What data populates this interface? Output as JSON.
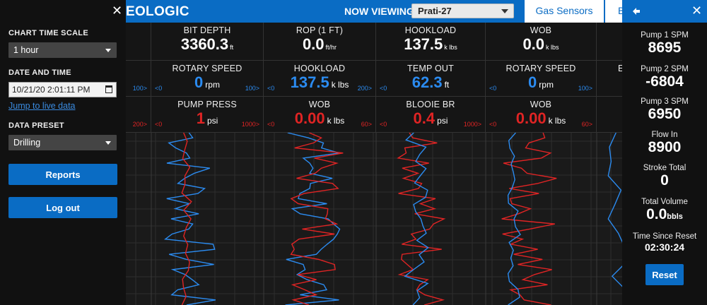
{
  "topbar": {
    "brand": "EOLOGIC",
    "now_viewing_label": "NOW VIEWING",
    "well": "Prati-27",
    "tab_active": "Gas Sensors",
    "tab_next": "B",
    "colors": {
      "bar": "#0a6cc4"
    }
  },
  "metrics": {
    "row1": [
      {
        "label": "BIT DEPTH",
        "value": "3360.3",
        "unit": "ft"
      },
      {
        "label": "ROP (1 FT)",
        "value": "0.0",
        "unit": "ft/hr"
      },
      {
        "label": "HOOKLOAD",
        "value": "137.5",
        "unit": "k lbs"
      },
      {
        "label": "WOB",
        "value": "0.0",
        "unit": "k lbs"
      }
    ],
    "row2": [
      {
        "label": "",
        "min": "",
        "max": "100>"
      },
      {
        "label": "ROTARY SPEED",
        "value": "0",
        "unit": "rpm",
        "min": "<0",
        "max": "100>"
      },
      {
        "label": "HOOKLOAD",
        "value": "137.5",
        "unit": "k lbs",
        "min": "<0",
        "max": "200>"
      },
      {
        "label": "TEMP OUT",
        "value": "62.3",
        "unit": "ft",
        "min": "<0",
        "max": ""
      },
      {
        "label": "ROTARY SPEED",
        "value": "0",
        "unit": "rpm",
        "min": "<0",
        "max": "100>"
      },
      {
        "label": "E"
      }
    ],
    "row3": [
      {
        "label": "",
        "max": "200>"
      },
      {
        "label": "PUMP PRESS",
        "value": "1",
        "unit": "psi",
        "min": "<0",
        "max": "1000>"
      },
      {
        "label": "WOB",
        "value": "0.00",
        "unit": "k lbs",
        "min": "<0",
        "max": "60>"
      },
      {
        "label": "BLOOIE BR",
        "value": "0.4",
        "unit": "psi",
        "min": "<0",
        "max": "1000>"
      },
      {
        "label": "WOB",
        "value": "0.00",
        "unit": "k lbs",
        "min": "<0",
        "max": "60>"
      }
    ],
    "row1_left_arrow": "‹"
  },
  "drawer": {
    "chart_time_scale_label": "CHART TIME SCALE",
    "chart_time_scale_value": "1 hour",
    "date_time_label": "DATE AND TIME",
    "date_time_value": "10/21/20  2:01:11 PM",
    "jump_link": "Jump to live data",
    "data_preset_label": "DATA PRESET",
    "data_preset_value": "Drilling",
    "reports_button": "Reports",
    "logout_button": "Log out",
    "close": "✕"
  },
  "right_panel": {
    "close": "✕",
    "stats": [
      {
        "label": "Pump 1 SPM",
        "value": "8695"
      },
      {
        "label": "Pump 2 SPM",
        "value": "-6804"
      },
      {
        "label": "Pump 3 SPM",
        "value": "6950"
      },
      {
        "label": "Flow In",
        "value": "8900"
      },
      {
        "label": "Stroke Total",
        "value": "0"
      },
      {
        "label": "Total Volume",
        "value": "0.0",
        "unit": "bbls"
      },
      {
        "label": "Time Since Reset",
        "value": "02:30:24"
      }
    ],
    "reset_button": "Reset"
  },
  "colors": {
    "accent": "#0a6cc4",
    "blue_trace": "#2b8bf0",
    "red_trace": "#e02424"
  }
}
